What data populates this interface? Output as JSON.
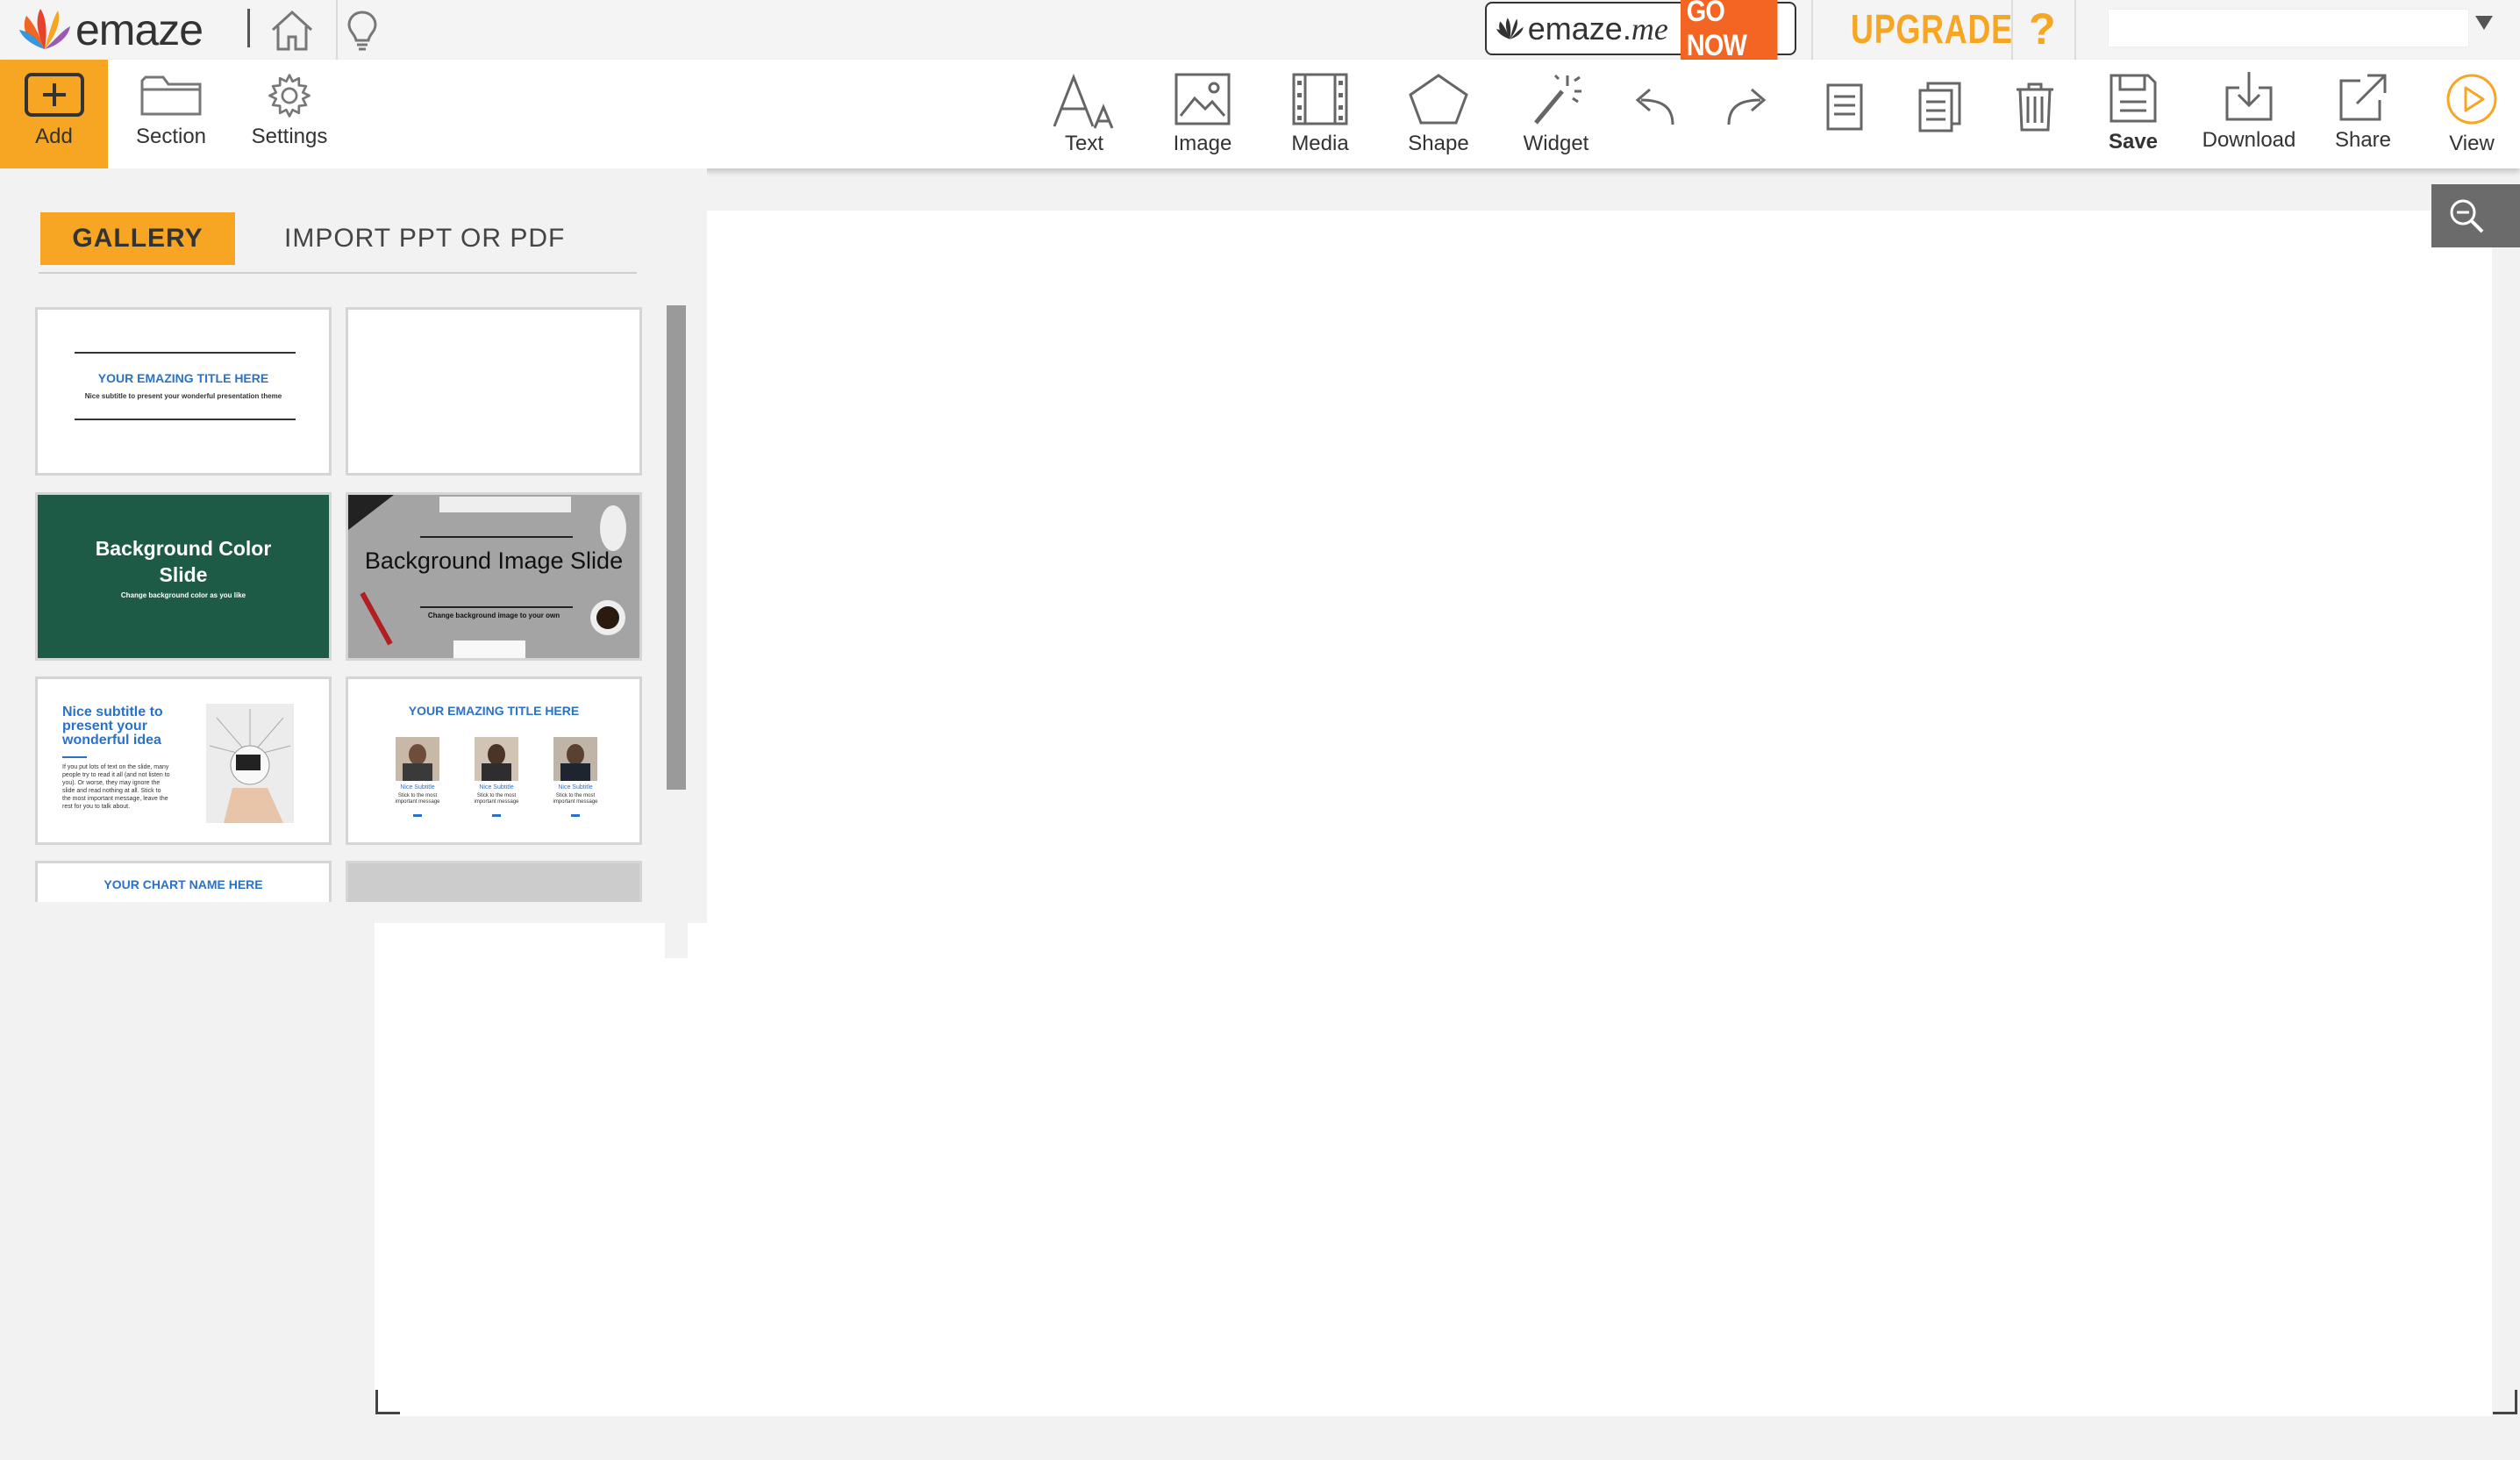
{
  "header": {
    "logo_text": "emaze",
    "emazeme_text": "emaze.",
    "emazeme_italic": "me",
    "gonow_label": "GO NOW",
    "upgrade_label": "UPGRADE",
    "help_label": "?",
    "search_value": ""
  },
  "toolbar": {
    "add": "Add",
    "section": "Section",
    "settings": "Settings",
    "text": "Text",
    "image": "Image",
    "media": "Media",
    "shape": "Shape",
    "widget": "Widget",
    "save": "Save",
    "download": "Download",
    "share": "Share",
    "view": "View"
  },
  "panel": {
    "tab_gallery": "GALLERY",
    "tab_import": "IMPORT PPT OR PDF"
  },
  "thumbnails": {
    "t1_title": "YOUR EMAZING TITLE HERE",
    "t1_sub": "Nice subtitle to present your wonderful presentation theme",
    "t3_title": "Background Color Slide",
    "t3_sub": "Change background color as you like",
    "t4_title": "Background Image Slide",
    "t4_sub": "Change background image to your own",
    "t5_title": "Nice subtitle to present your wonderful idea",
    "t5_body": "If you put lots of text on the slide, many people try to read it all (and not listen to you). Or worse, they may ignore the slide and read nothing at all. Stick to the most important message, leave the rest for you to talk about.",
    "t6_title": "YOUR EMAZING TITLE HERE",
    "t6_name": "Nice Subtitle",
    "t6_desc": "Stick to the most important message",
    "t7_title": "YOUR CHART NAME HERE"
  },
  "colors": {
    "accent_orange": "#f6a623",
    "gonow_orange": "#f26522",
    "thumb_green": "#1e5b46",
    "title_blue": "#2a72c8"
  }
}
